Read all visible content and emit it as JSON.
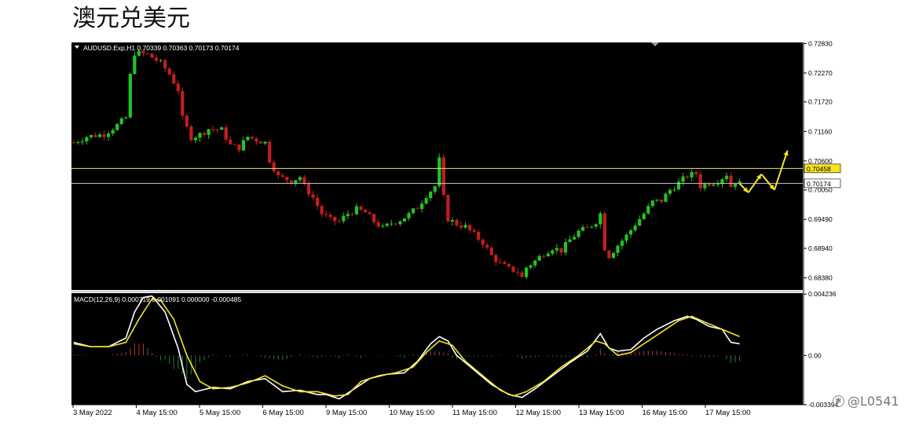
{
  "page": {
    "title": "澳元兑美元"
  },
  "watermark": {
    "text": "@L0541",
    "icon": "camera-icon"
  },
  "chart_data": [
    {
      "type": "candlestick",
      "symbol_line": "AUDUSD.Exp,H1  0.70339 0.70363 0.70173 0.70174",
      "ylim": [
        0.6815,
        0.7285
      ],
      "y_ticks": [
        "0.72830",
        "0.72270",
        "0.71720",
        "0.71160",
        "0.70600",
        "0.70050",
        "0.69490",
        "0.68940",
        "0.68380"
      ],
      "x_ticks": [
        "3 May 2022",
        "4 May 15:00",
        "5 May 15:00",
        "6 May 15:00",
        "9 May 15:00",
        "10 May 15:00",
        "11 May 15:00",
        "12 May 15:00",
        "13 May 15:00",
        "16 May 15:00",
        "17 May 15:00"
      ],
      "grid": false,
      "horizontal_levels": [
        {
          "value": 0.70458,
          "label": "0.70458",
          "color": "#f2e36a"
        },
        {
          "value": 0.70174,
          "label": "0.70174",
          "color": "#c8c8c8"
        }
      ],
      "price_path": [
        [
          0,
          0.7095
        ],
        [
          3,
          0.7106
        ],
        [
          7,
          0.7111
        ],
        [
          10,
          0.7128
        ],
        [
          12,
          0.7142
        ],
        [
          13,
          0.7222
        ],
        [
          14,
          0.7265
        ],
        [
          17,
          0.7262
        ],
        [
          20,
          0.7246
        ],
        [
          22,
          0.7225
        ],
        [
          24,
          0.7195
        ],
        [
          25,
          0.714
        ],
        [
          27,
          0.7105
        ],
        [
          29,
          0.711
        ],
        [
          31,
          0.7121
        ],
        [
          34,
          0.7119
        ],
        [
          36,
          0.709
        ],
        [
          38,
          0.7085
        ],
        [
          40,
          0.7106
        ],
        [
          42,
          0.71
        ],
        [
          44,
          0.7095
        ],
        [
          45,
          0.7062
        ],
        [
          47,
          0.703
        ],
        [
          50,
          0.7022
        ],
        [
          52,
          0.703
        ],
        [
          53,
          0.7012
        ],
        [
          55,
          0.699
        ],
        [
          57,
          0.696
        ],
        [
          59,
          0.6948
        ],
        [
          61,
          0.6945
        ],
        [
          63,
          0.696
        ],
        [
          65,
          0.6968
        ],
        [
          67,
          0.6962
        ],
        [
          69,
          0.6945
        ],
        [
          71,
          0.6932
        ],
        [
          73,
          0.6942
        ],
        [
          75,
          0.6948
        ],
        [
          77,
          0.6958
        ],
        [
          79,
          0.6972
        ],
        [
          81,
          0.6995
        ],
        [
          83,
          0.7012
        ],
        [
          84,
          0.7062
        ],
        [
          85,
          0.699
        ],
        [
          86,
          0.695
        ],
        [
          88,
          0.694
        ],
        [
          90,
          0.6935
        ],
        [
          92,
          0.692
        ],
        [
          94,
          0.6905
        ],
        [
          96,
          0.688
        ],
        [
          98,
          0.6865
        ],
        [
          100,
          0.6855
        ],
        [
          102,
          0.685
        ],
        [
          103,
          0.6838
        ],
        [
          104,
          0.6858
        ],
        [
          106,
          0.687
        ],
        [
          108,
          0.6885
        ],
        [
          110,
          0.6895
        ],
        [
          112,
          0.689
        ],
        [
          114,
          0.691
        ],
        [
          116,
          0.6926
        ],
        [
          118,
          0.6932
        ],
        [
          120,
          0.6945
        ],
        [
          121,
          0.696
        ],
        [
          122,
          0.6895
        ],
        [
          123,
          0.688
        ],
        [
          125,
          0.69
        ],
        [
          127,
          0.6918
        ],
        [
          129,
          0.694
        ],
        [
          131,
          0.696
        ],
        [
          133,
          0.6982
        ],
        [
          135,
          0.6985
        ],
        [
          137,
          0.7005
        ],
        [
          139,
          0.7018
        ],
        [
          141,
          0.7032
        ],
        [
          143,
          0.7036
        ],
        [
          144,
          0.7012
        ],
        [
          146,
          0.7018
        ],
        [
          148,
          0.7022
        ],
        [
          150,
          0.7035
        ],
        [
          151,
          0.7012
        ],
        [
          152,
          0.7022
        ],
        [
          153,
          0.7017
        ]
      ],
      "projection": [
        [
          153,
          0.7017
        ],
        [
          155,
          0.7
        ],
        [
          158,
          0.7035
        ],
        [
          161,
          0.7005
        ],
        [
          164,
          0.708
        ]
      ],
      "projection_color": "#f5e621"
    },
    {
      "type": "macd",
      "label": "MACD(12,26,9) 0.000719 0.001091 0.000000 -0.000485",
      "ylim": [
        -0.0034,
        0.0043
      ],
      "y_ticks": [
        "0.004236",
        "0.00",
        "-0.003394"
      ],
      "series": [
        {
          "name": "macd",
          "color": "#ffffff",
          "values": [
            [
              0,
              0.0009
            ],
            [
              4,
              0.0006
            ],
            [
              8,
              0.0006
            ],
            [
              12,
              0.0012
            ],
            [
              14,
              0.003
            ],
            [
              16,
              0.004
            ],
            [
              18,
              0.0041
            ],
            [
              21,
              0.003
            ],
            [
              24,
              0.0005
            ],
            [
              26,
              -0.002
            ],
            [
              28,
              -0.0025
            ],
            [
              32,
              -0.0022
            ],
            [
              36,
              -0.0023
            ],
            [
              40,
              -0.0018
            ],
            [
              44,
              -0.0016
            ],
            [
              48,
              -0.0025
            ],
            [
              52,
              -0.0024
            ],
            [
              56,
              -0.0027
            ],
            [
              58,
              -0.0027
            ],
            [
              61,
              -0.003
            ],
            [
              64,
              -0.0024
            ],
            [
              68,
              -0.0016
            ],
            [
              72,
              -0.0013
            ],
            [
              76,
              -0.0012
            ],
            [
              79,
              -0.0004
            ],
            [
              82,
              0.0008
            ],
            [
              84,
              0.0013
            ],
            [
              86,
              0.001
            ],
            [
              88,
              0.0
            ],
            [
              92,
              -0.001
            ],
            [
              96,
              -0.002
            ],
            [
              100,
              -0.0027
            ],
            [
              103,
              -0.0029
            ],
            [
              106,
              -0.0023
            ],
            [
              110,
              -0.0014
            ],
            [
              114,
              -0.0005
            ],
            [
              118,
              0.0003
            ],
            [
              121,
              0.0015
            ],
            [
              123,
              0.0005
            ],
            [
              125,
              0.0003
            ],
            [
              128,
              0.0004
            ],
            [
              131,
              0.0012
            ],
            [
              134,
              0.0018
            ],
            [
              138,
              0.0024
            ],
            [
              141,
              0.0027
            ],
            [
              143,
              0.0025
            ],
            [
              146,
              0.002
            ],
            [
              149,
              0.0018
            ],
            [
              151,
              0.0009
            ],
            [
              153,
              0.0008
            ]
          ]
        },
        {
          "name": "signal",
          "color": "#f5e621",
          "values": [
            [
              0,
              0.0008
            ],
            [
              4,
              0.0006
            ],
            [
              8,
              0.0006
            ],
            [
              12,
              0.0009
            ],
            [
              15,
              0.0025
            ],
            [
              18,
              0.0039
            ],
            [
              20,
              0.0038
            ],
            [
              23,
              0.0025
            ],
            [
              26,
              0.0
            ],
            [
              29,
              -0.0018
            ],
            [
              32,
              -0.0023
            ],
            [
              36,
              -0.0022
            ],
            [
              40,
              -0.0019
            ],
            [
              44,
              -0.0014
            ],
            [
              48,
              -0.0021
            ],
            [
              52,
              -0.0025
            ],
            [
              56,
              -0.0025
            ],
            [
              60,
              -0.0028
            ],
            [
              63,
              -0.0027
            ],
            [
              66,
              -0.0018
            ],
            [
              70,
              -0.0014
            ],
            [
              74,
              -0.0012
            ],
            [
              78,
              -0.0008
            ],
            [
              81,
              0.0002
            ],
            [
              84,
              0.001
            ],
            [
              87,
              0.0007
            ],
            [
              90,
              -0.0004
            ],
            [
              94,
              -0.0014
            ],
            [
              98,
              -0.0024
            ],
            [
              101,
              -0.0028
            ],
            [
              104,
              -0.0025
            ],
            [
              108,
              -0.0018
            ],
            [
              112,
              -0.0008
            ],
            [
              116,
              0.0
            ],
            [
              120,
              0.001
            ],
            [
              122,
              0.0008
            ],
            [
              125,
              0.0
            ],
            [
              128,
              0.0002
            ],
            [
              131,
              0.0008
            ],
            [
              135,
              0.0016
            ],
            [
              139,
              0.0024
            ],
            [
              142,
              0.0027
            ],
            [
              145,
              0.0023
            ],
            [
              149,
              0.0018
            ],
            [
              153,
              0.0013
            ]
          ]
        }
      ],
      "histogram_colors": {
        "positive": "#b33a3a",
        "negative": "#2e7d32"
      }
    }
  ],
  "colors": {
    "panel_bg": "#000000",
    "bull": "#22c322",
    "bear": "#c21e1e",
    "axis_text": "#000000",
    "panel_text": "#ffffff"
  }
}
